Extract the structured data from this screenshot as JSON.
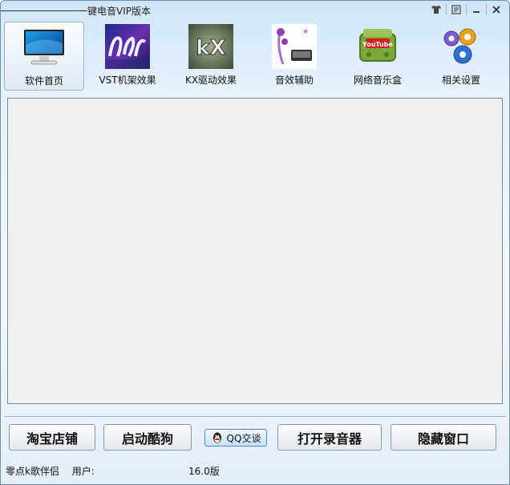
{
  "window": {
    "title": "一键电音VIP版本"
  },
  "titlebar_buttons": [
    "skin",
    "menu",
    "minimize",
    "close"
  ],
  "toolbar": {
    "items": [
      {
        "id": "home",
        "label": "软件首页",
        "icon": "monitor-icon",
        "active": true
      },
      {
        "id": "vst",
        "label": "VST机架效果",
        "icon": "vst-rack-icon",
        "active": false
      },
      {
        "id": "kx",
        "label": "KX驱动效果",
        "icon": "kx-driver-icon",
        "active": false
      },
      {
        "id": "sound",
        "label": "音效辅助",
        "icon": "headset-icon",
        "active": false
      },
      {
        "id": "music",
        "label": "网络音乐盒",
        "icon": "youtube-radio-icon",
        "active": false
      },
      {
        "id": "settings",
        "label": "相关设置",
        "icon": "gears-icon",
        "active": false
      }
    ]
  },
  "footer": {
    "taobao_label": "淘宝店铺",
    "kugou_label": "启动酷狗",
    "qq_label": "QQ交谈",
    "recorder_label": "打开录音器",
    "hide_label": "隐藏窗口"
  },
  "status": {
    "app_name": "零点k歌伴侣",
    "user_label": "用户:",
    "user_value": "",
    "version": "16.0版"
  },
  "colors": {
    "accent": "#3a7bd5",
    "panel_bg": "#f0f0f0"
  }
}
